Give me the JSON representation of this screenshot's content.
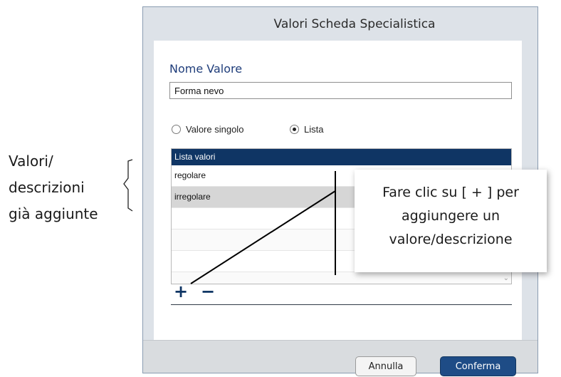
{
  "annotation": {
    "lines": [
      "Valori/",
      "descrizioni",
      "già aggiunte"
    ]
  },
  "dialog": {
    "title": "Valori Scheda Specialistica",
    "field_label": "Nome Valore",
    "field_value": "Forma nevo",
    "radio_single": "Valore singolo",
    "radio_list": "Lista",
    "list": {
      "header": "Lista valori",
      "items": [
        "regolare",
        "irregolare"
      ]
    },
    "add_symbol": "+",
    "remove_symbol": "−",
    "cancel_label": "Annulla",
    "confirm_label": "Conferma"
  },
  "callout": {
    "lines": [
      "Fare clic su [ + ] per",
      "aggiungere un",
      "valore/descrizione"
    ]
  },
  "colors": {
    "accent": "#0f3564",
    "confirm": "#1e4c86",
    "label": "#1f3d7a"
  }
}
